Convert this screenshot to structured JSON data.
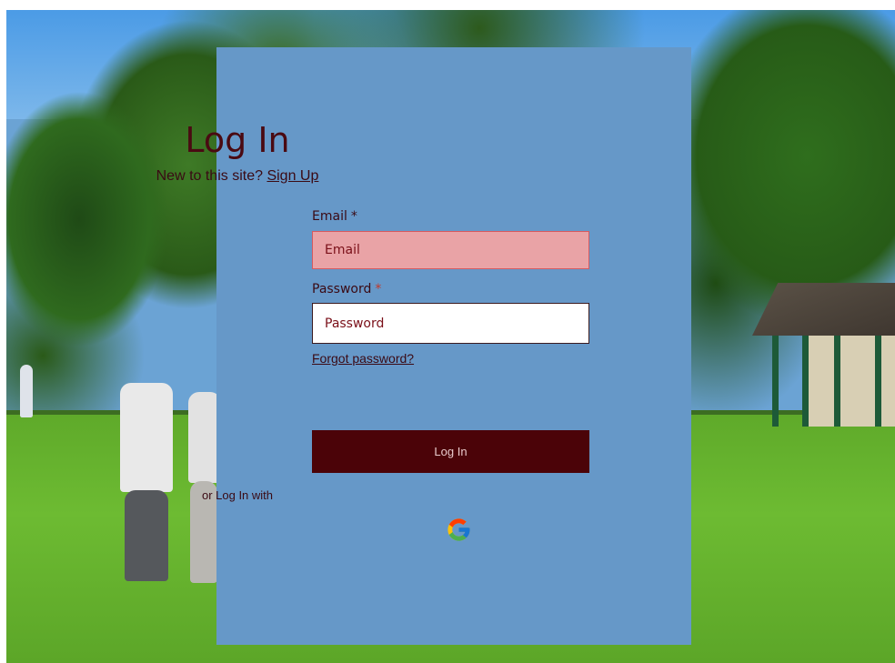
{
  "login": {
    "title": "Log In",
    "new_prompt": "New to this site?",
    "signup_link": "Sign Up",
    "email_label": "Email",
    "email_required_mark": "*",
    "email_placeholder": "Email",
    "password_label": "Password",
    "password_required_mark": "*",
    "password_placeholder": "Password",
    "forgot_link": "Forgot password?",
    "submit_label": "Log In",
    "alt_login_text": "or Log In with",
    "social_icon": "google-icon"
  },
  "colors": {
    "panel_background": "#6698c8",
    "title_text": "#4a0a12",
    "button_background": "#4b0308",
    "email_field_error_background": "#e9a3a6",
    "email_field_error_border": "#d65a5f"
  }
}
